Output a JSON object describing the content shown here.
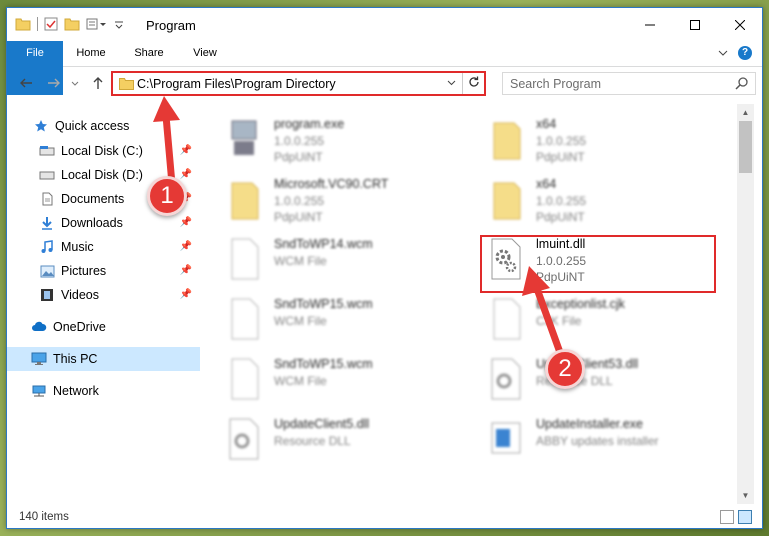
{
  "window": {
    "title": "Program"
  },
  "ribbon": {
    "tabs": [
      {
        "label": "File"
      },
      {
        "label": "Home"
      },
      {
        "label": "Share"
      },
      {
        "label": "View"
      }
    ]
  },
  "address": {
    "path": "C:\\Program Files\\Program Directory"
  },
  "search": {
    "placeholder": "Search Program"
  },
  "sidebar": {
    "items": [
      {
        "label": "Quick access",
        "icon": "star-icon",
        "pinned": false
      },
      {
        "label": "Local Disk (C:)",
        "icon": "drive-icon",
        "pinned": true
      },
      {
        "label": "Local Disk (D:)",
        "icon": "drive-icon",
        "pinned": true
      },
      {
        "label": "Documents",
        "icon": "documents-icon",
        "pinned": true
      },
      {
        "label": "Downloads",
        "icon": "download-icon",
        "pinned": true
      },
      {
        "label": "Music",
        "icon": "music-icon",
        "pinned": true
      },
      {
        "label": "Pictures",
        "icon": "pictures-icon",
        "pinned": true
      },
      {
        "label": "Videos",
        "icon": "videos-icon",
        "pinned": true
      },
      {
        "label": "OneDrive",
        "icon": "cloud-icon",
        "pinned": false
      },
      {
        "label": "This PC",
        "icon": "monitor-icon",
        "pinned": false,
        "selected": true
      },
      {
        "label": "Network",
        "icon": "network-icon",
        "pinned": false
      }
    ]
  },
  "files": [
    {
      "name": "program.exe",
      "version": "1.0.0.255",
      "type": "PdpUiNT"
    },
    {
      "name": "x64",
      "version": "1.0.0.255",
      "type": "PdpUiNT"
    },
    {
      "name": "Microsoft.VC90.CRT",
      "version": "1.0.0.255",
      "type": "PdpUiNT"
    },
    {
      "name": "x64",
      "version": "1.0.0.255",
      "type": "PdpUiNT"
    },
    {
      "name": "SndToWP14.wcm",
      "version": "",
      "type": "WCM File"
    },
    {
      "name": "lmuint.dll",
      "version": "1.0.0.255",
      "type": "PdpUiNT"
    },
    {
      "name": "SndToWP15.wcm",
      "version": "",
      "type": "WCM File"
    },
    {
      "name": "Exceptionlist.cjk",
      "version": "",
      "type": "CJK File"
    },
    {
      "name": "SndToWP15.wcm",
      "version": "",
      "type": "WCM File"
    },
    {
      "name": "UpdateClient53.dll",
      "version": "",
      "type": "Resource DLL"
    },
    {
      "name": "UpdateClient5.dll",
      "version": "",
      "type": "Resource DLL"
    },
    {
      "name": "UpdateInstaller.exe",
      "version": "",
      "type": "ABBY updates installer"
    }
  ],
  "status": {
    "item_count": "140 items"
  },
  "annotations": {
    "step1": "1",
    "step2": "2"
  },
  "colors": {
    "accent": "#1979ca",
    "highlight": "#e02a2a",
    "badge": "#e53935"
  }
}
